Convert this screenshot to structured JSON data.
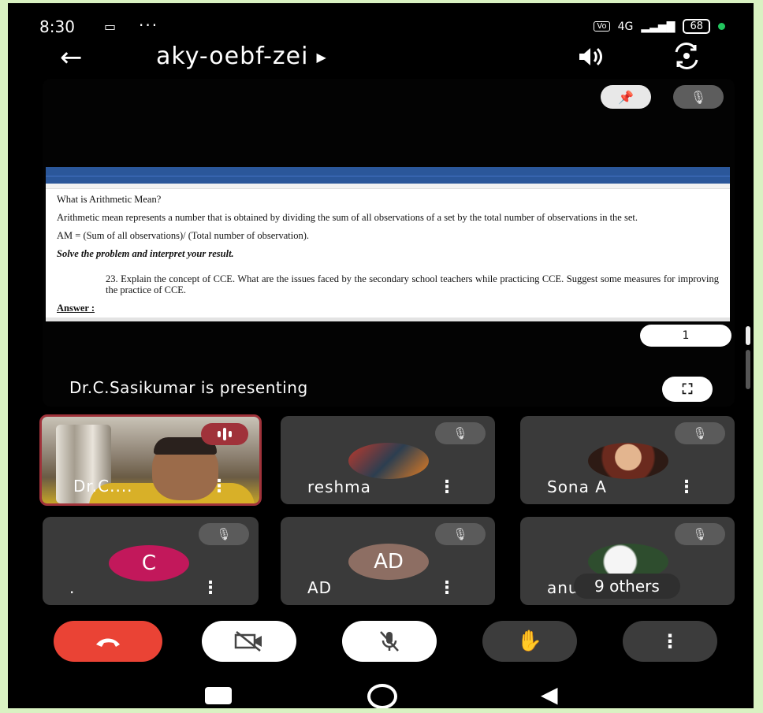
{
  "status_bar": {
    "time": "8:30",
    "network": "4G",
    "battery": "68"
  },
  "header": {
    "meeting_code": "aky-oebf-zei"
  },
  "presentation": {
    "presenter_text": "Dr.C.Sasikumar is presenting",
    "page_number": "1",
    "document": {
      "heading": "What is Arithmetic Mean?",
      "para1": "Arithmetic mean represents a number that is obtained by dividing the sum of all observations of a set by the total number of observations in the set.",
      "formula": "AM = (Sum of all observations)/ (Total number of observation).",
      "instruction": "Solve the problem and interpret your result.",
      "question": "23. Explain the concept of CCE. What are the issues faced by the secondary school teachers while practicing CCE. Suggest some measures for improving the practice of CCE.",
      "answer_label": "Answer :"
    }
  },
  "participants": [
    {
      "name": "Dr.C....",
      "speaking": true
    },
    {
      "name": "reshma"
    },
    {
      "name": "Sona A"
    },
    {
      "name": ".",
      "initial": "C",
      "avatar_color": "#c2185b"
    },
    {
      "name": "AD",
      "initial": "AD",
      "avatar_color": "#8d6e63"
    },
    {
      "name": "anu",
      "overlay": "9 others"
    }
  ],
  "colors": {
    "end_call": "#ea4335",
    "speaking": "#a0323a"
  }
}
